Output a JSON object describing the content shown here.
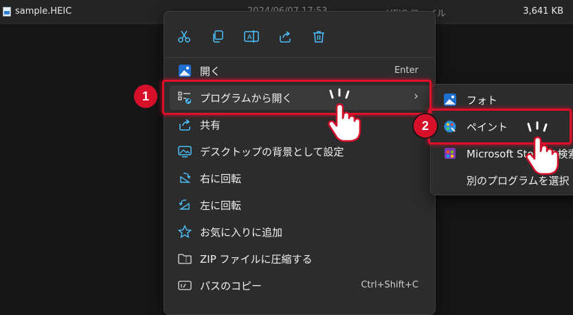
{
  "file": {
    "name": "sample.HEIC",
    "date": "2024/06/07 17:53",
    "type": "HEIC ファイル",
    "size": "3,641 KB"
  },
  "toolbar_icons": [
    "cut-icon",
    "copy-icon",
    "rename-icon",
    "share-icon",
    "delete-icon"
  ],
  "menu": {
    "items": [
      {
        "label": "開く",
        "shortcut": "Enter",
        "icon": "photos-icon"
      },
      {
        "label": "プログラムから開く",
        "icon": "open-with-icon"
      },
      {
        "label": "共有",
        "icon": "share-icon"
      },
      {
        "label": "デスクトップの背景として設定",
        "icon": "wallpaper-icon"
      },
      {
        "label": "右に回転",
        "icon": "rotate-right-icon"
      },
      {
        "label": "左に回転",
        "icon": "rotate-left-icon"
      },
      {
        "label": "お気に入りに追加",
        "icon": "star-icon"
      },
      {
        "label": "ZIP ファイルに圧縮する",
        "icon": "zip-folder-icon"
      },
      {
        "label": "パスのコピー",
        "shortcut": "Ctrl+Shift+C",
        "icon": "copy-path-icon"
      }
    ]
  },
  "submenu": {
    "items": [
      {
        "label": "フォト",
        "icon": "photos-icon"
      },
      {
        "label": "ペイント",
        "icon": "paint-icon"
      },
      {
        "label": "Microsoft Store を検索",
        "icon": "store-icon"
      },
      {
        "label": "別のプログラムを選択",
        "icon": ""
      }
    ]
  },
  "callouts": {
    "step1": "1",
    "step2": "2"
  },
  "colors": {
    "highlight": "#e0102a",
    "accent": "#4cc2ff",
    "menu_bg": "#2c2c2c"
  }
}
